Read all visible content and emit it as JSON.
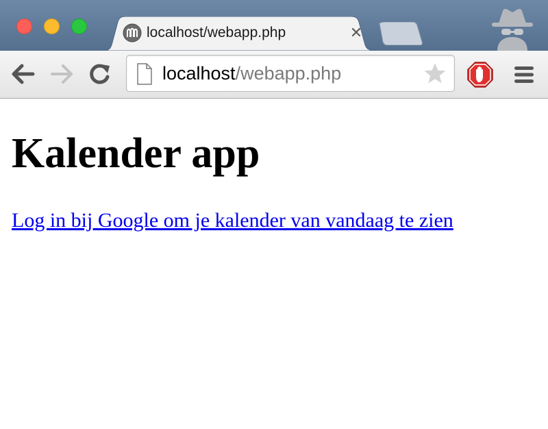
{
  "browser": {
    "tab": {
      "title": "localhost/webapp.php",
      "close_glyph": "✕",
      "favicon": "globe-icon"
    },
    "address_bar": {
      "host": "localhost",
      "path": "/webapp.php"
    },
    "icons": {
      "back": "arrow-left-icon",
      "forward": "arrow-right-icon",
      "reload": "reload-icon",
      "bookmark": "star-icon",
      "extension": "adblock-stop-hand-icon",
      "menu": "hamburger-menu-icon",
      "profile": "incognito-icon"
    },
    "colors": {
      "titlebar": "#5f7a9a",
      "close_button": "#fc5f57",
      "minimize_button": "#fdbc2e",
      "maximize_button": "#29c840",
      "extension_red": "#e0312e"
    }
  },
  "page": {
    "heading": "Kalender app",
    "login_link": "Log in bij Google om je kalender van vandaag te zien",
    "colors": {
      "link": "#0000ee",
      "text": "#000000"
    }
  }
}
